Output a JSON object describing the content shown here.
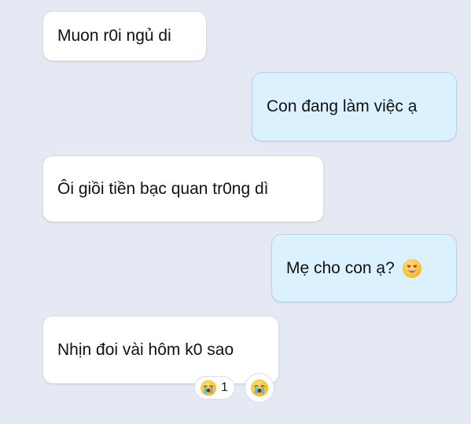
{
  "messages": [
    {
      "direction": "incoming",
      "text": "Muon r0i ngủ di"
    },
    {
      "direction": "outgoing",
      "text": "Con đang làm việc ạ"
    },
    {
      "direction": "incoming",
      "text": "Ôi giồi tiền bạc quan tr0ng dì"
    },
    {
      "direction": "outgoing",
      "text": "Mẹ cho con ạ?",
      "emoji": "smiling-face-with-heart-eyes"
    },
    {
      "direction": "incoming",
      "text": "Nhịn đoi vài hôm k0 sao"
    }
  ],
  "reactions": {
    "emoji": "loudly-crying-face",
    "count": "1",
    "add_reaction_emoji": "loudly-crying-face"
  },
  "colors": {
    "background": "#e5e9f3",
    "incoming_bubble": "#ffffff",
    "outgoing_bubble": "#dbf1fd"
  }
}
